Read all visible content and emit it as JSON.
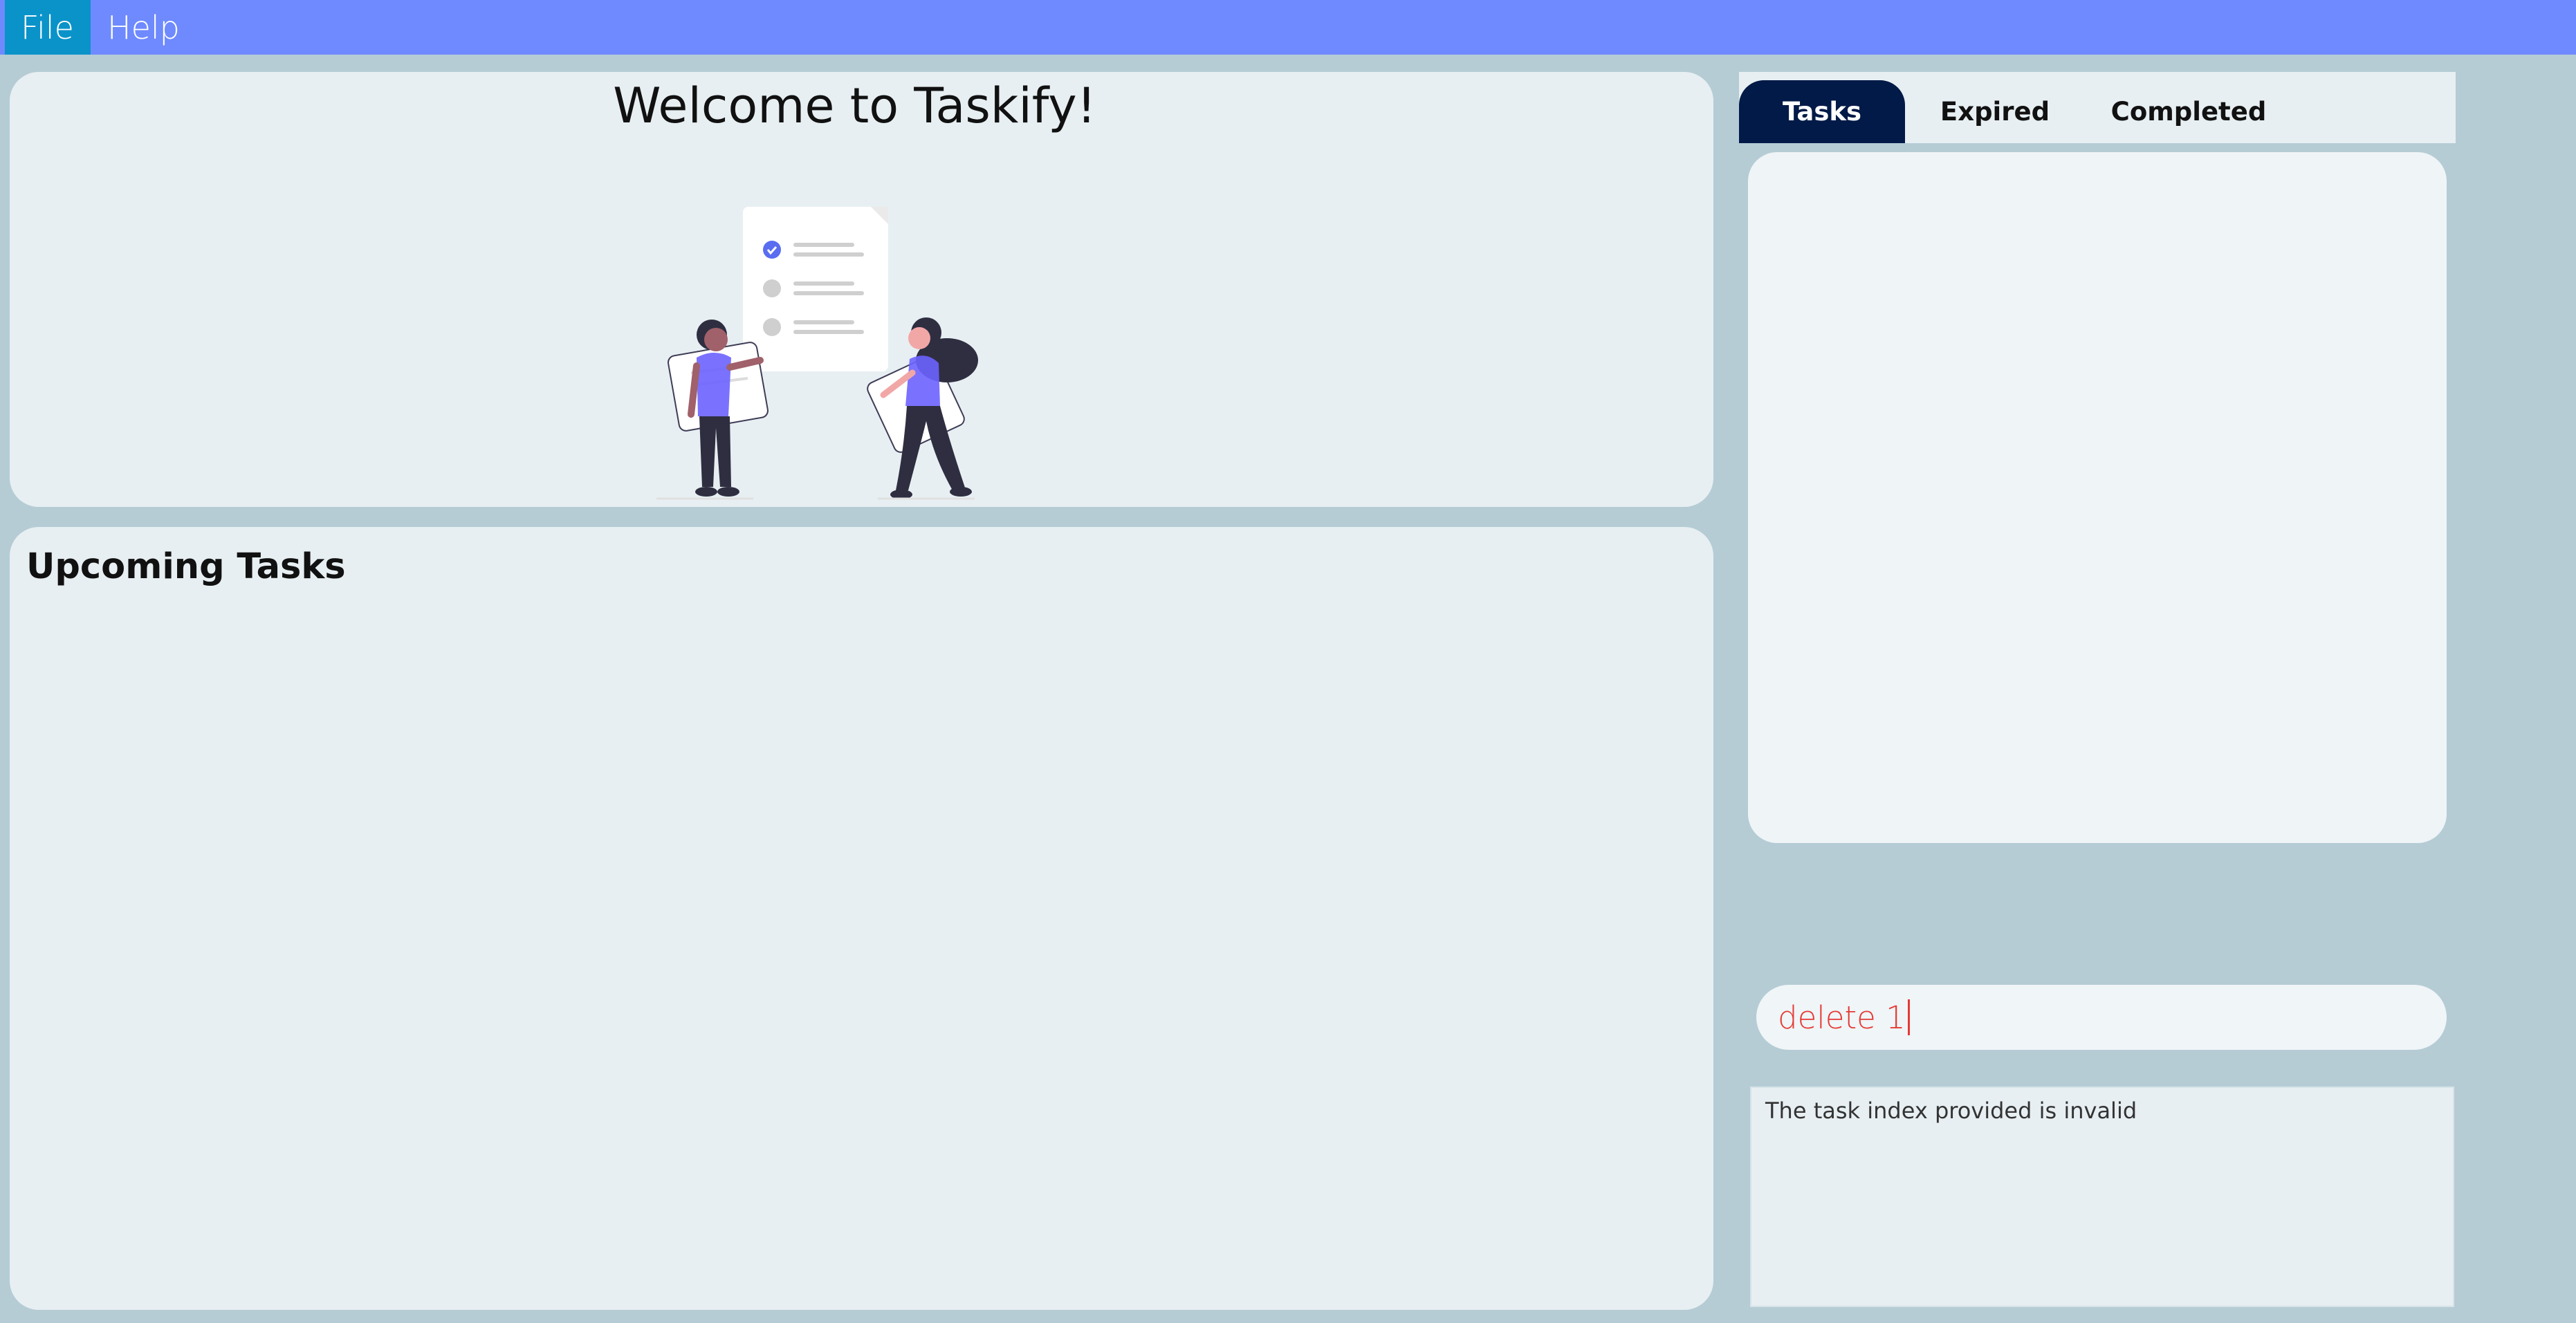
{
  "menu": {
    "file_label": "File",
    "help_label": "Help"
  },
  "welcome": {
    "title": "Welcome to Taskify!"
  },
  "upcoming": {
    "title": "Upcoming Tasks"
  },
  "tabs": [
    {
      "label": "Tasks",
      "active": true
    },
    {
      "label": "Expired",
      "active": false
    },
    {
      "label": "Completed",
      "active": false
    }
  ],
  "command": {
    "value": "delete 1"
  },
  "result": {
    "message": "The task index provided is invalid"
  },
  "colors": {
    "menubar": "#6f8afe",
    "menu_active": "#0a93c9",
    "background": "#b5ccd5",
    "panel": "#e7eff2",
    "tab_active": "#021a47",
    "error_text": "#e53935"
  }
}
